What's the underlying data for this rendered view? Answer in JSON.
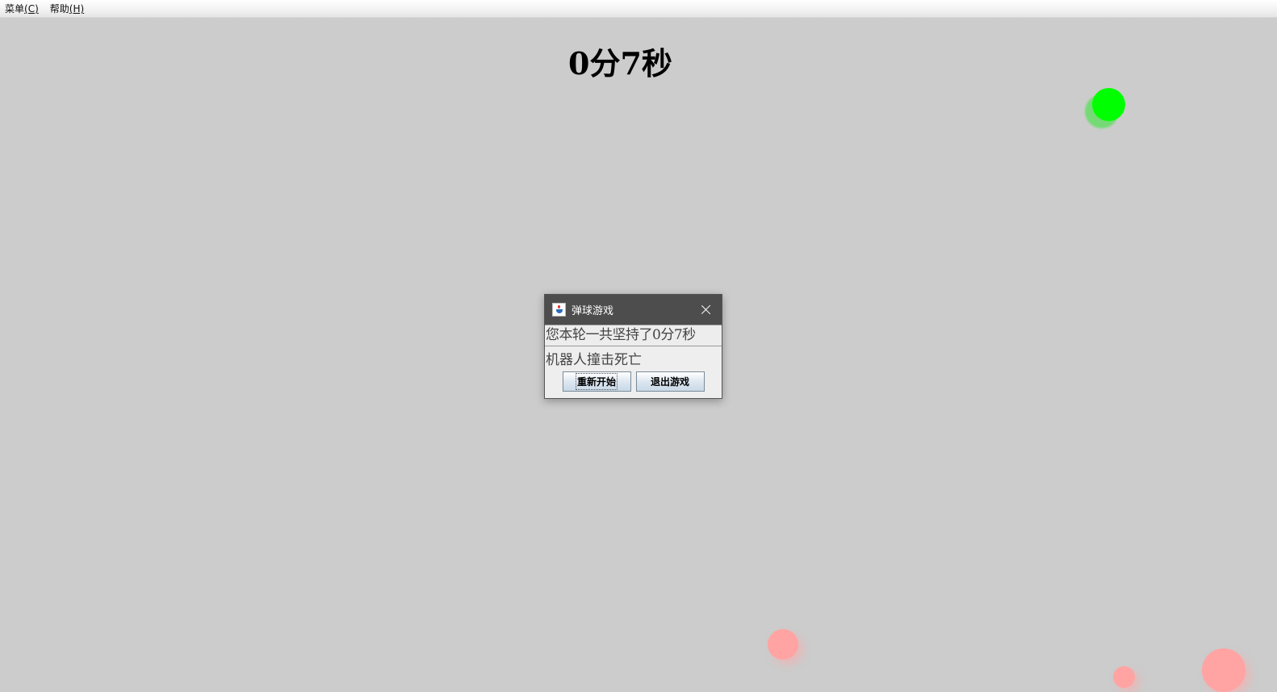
{
  "menubar": {
    "items": [
      {
        "label": "菜单",
        "mnemonic": "(C)"
      },
      {
        "label": "帮助",
        "mnemonic": "(H)"
      }
    ]
  },
  "game": {
    "timer": "0分7秒",
    "colors": {
      "background": "#cccccc",
      "player_ball": "#00ff00",
      "enemy_ball": "#ffa3a3"
    }
  },
  "dialog": {
    "title": "弹球游戏",
    "message_time": "您本轮一共坚持了0分7秒",
    "message_reason": "机器人撞击死亡",
    "restart_label": "重新开始",
    "exit_label": "退出游戏"
  }
}
